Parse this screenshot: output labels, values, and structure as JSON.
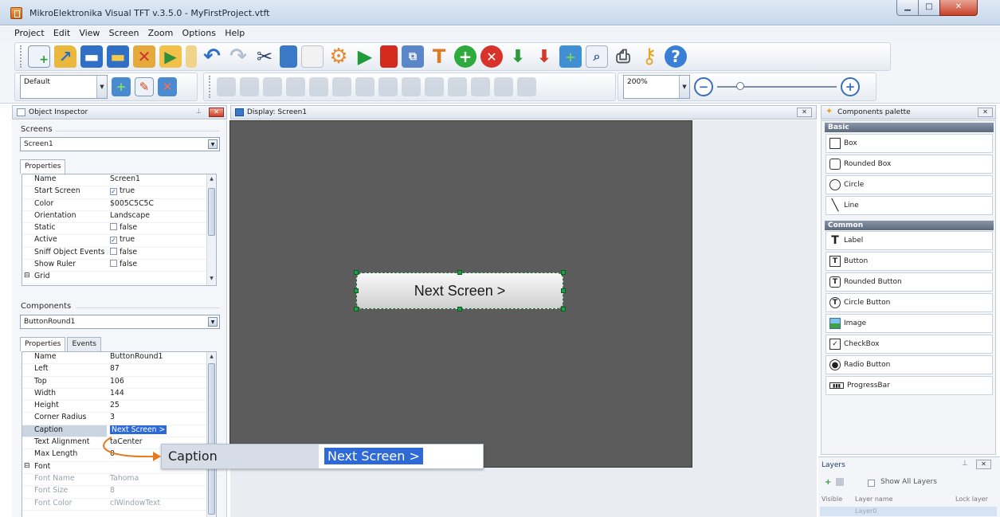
{
  "window": {
    "title": "MikroElektronika Visual TFT v.3.5.0 - MyFirstProject.vtft",
    "min": "▁",
    "max": "□",
    "close": "✕"
  },
  "menu": [
    "Project",
    "Edit",
    "View",
    "Screen",
    "Zoom",
    "Options",
    "Help"
  ],
  "toolbar": {
    "style_value": "Default",
    "zoom_value": "200%",
    "icons": [
      "new-project",
      "open",
      "save",
      "save-as",
      "close-project",
      "run",
      "undo",
      "redo",
      "cut",
      "copy",
      "paste",
      "settings",
      "play",
      "stop",
      "generate",
      "tools",
      "add",
      "delete",
      "import",
      "export",
      "screen-add",
      "preview",
      "print",
      "key",
      "help"
    ]
  },
  "inspector": {
    "title": "Object Inspector",
    "screens_label": "Screens",
    "screen_value": "Screen1",
    "tab_properties": "Properties",
    "tab_events": "Events",
    "screen_props": [
      {
        "name": "Name",
        "value": "Screen1"
      },
      {
        "name": "Start Screen",
        "value": "true",
        "check": "✓"
      },
      {
        "name": "Color",
        "value": "$005C5C5C"
      },
      {
        "name": "Orientation",
        "value": "Landscape"
      },
      {
        "name": "Static",
        "value": "false",
        "check": ""
      },
      {
        "name": "Active",
        "value": "true",
        "check": "✓"
      },
      {
        "name": "Sniff Object Events",
        "value": "false",
        "check": ""
      },
      {
        "name": "Show Ruler",
        "value": "false",
        "check": ""
      },
      {
        "name": "Grid",
        "value": ""
      }
    ],
    "components_label": "Components",
    "component_value": "ButtonRound1",
    "component_props": [
      {
        "name": "Name",
        "value": "ButtonRound1"
      },
      {
        "name": "Left",
        "value": "87"
      },
      {
        "name": "Top",
        "value": "106"
      },
      {
        "name": "Width",
        "value": "144"
      },
      {
        "name": "Height",
        "value": "25"
      },
      {
        "name": "Corner Radius",
        "value": "3"
      },
      {
        "name": "Caption",
        "value": "Next Screen >"
      },
      {
        "name": "Text Alignment",
        "value": "taCenter"
      },
      {
        "name": "Max Length",
        "value": "0"
      },
      {
        "name": "Font",
        "value": ""
      },
      {
        "name": "Font Name",
        "value": "Tahoma"
      },
      {
        "name": "Font Size",
        "value": "8"
      },
      {
        "name": "Font Color",
        "value": "clWindowText"
      }
    ]
  },
  "display": {
    "title": "Display: Screen1",
    "button_caption": "Next Screen >"
  },
  "callout": {
    "label": "Caption",
    "value": "Next Screen >"
  },
  "palette": {
    "title": "Components palette",
    "cat_basic": "Basic",
    "basic": [
      "Box",
      "Rounded Box",
      "Circle",
      "Line"
    ],
    "cat_common": "Common",
    "common": [
      "Label",
      "Button",
      "Rounded Button",
      "Circle Button",
      "Image",
      "CheckBox",
      "Radio Button",
      "ProgressBar"
    ]
  },
  "layers": {
    "title": "Layers",
    "show_all": "Show All Layers",
    "col_visible": "Visible",
    "col_name": "Layer name",
    "col_lock": "Lock layer",
    "row_name": "Layer0"
  },
  "colors": {
    "screen_bg": "#5C5C5C",
    "selection": "#2E6AD7",
    "handle": "#1FA045"
  }
}
